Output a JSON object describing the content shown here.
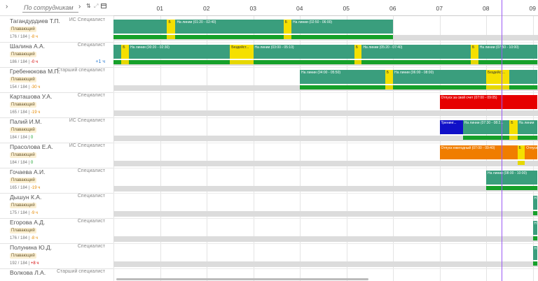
{
  "toolbar": {
    "expand_icon": "chevron-right",
    "search_placeholder": "По сотрудникам",
    "nav_icon": "chevron-right",
    "sort_icon": "sort",
    "calendar_icon": "calendar"
  },
  "timeline": {
    "hours": [
      "01",
      "02",
      "03",
      "04",
      "05",
      "06",
      "07",
      "08",
      "09"
    ]
  },
  "employees": [
    {
      "name": "Тагандурдиев Т.П.",
      "position": "ИС Специалист",
      "badge": "Плавающий",
      "hours": "176 / 184 |",
      "delta": "-8 ч",
      "delta_color": "#e68a00",
      "extra": ""
    },
    {
      "name": "Шалина А.А.",
      "position": "Специалист",
      "badge": "Плавающий",
      "hours": "186 / 184 |",
      "delta": "-0 ч",
      "delta_color": "#d40000",
      "extra": "+1 ч"
    },
    {
      "name": "Гребенюкова М.П.",
      "position": "Старший специалист",
      "badge": "Плавающий",
      "hours": "154 / 184 |",
      "delta": "-30 ч",
      "delta_color": "#e68a00",
      "extra": ""
    },
    {
      "name": "Карташова У.А.",
      "position": "Специалист",
      "badge": "Плавающий",
      "hours": "165 / 184 |",
      "delta": "-19 ч",
      "delta_color": "#e68a00",
      "extra": ""
    },
    {
      "name": "Палий И.М.",
      "position": "ИС Специалист",
      "badge": "Плавающий",
      "hours": "184 / 184 |",
      "delta": "0",
      "delta_color": "#16a12a",
      "extra": ""
    },
    {
      "name": "Прасолова Е.А.",
      "position": "ИС Специалист",
      "badge": "Плавающий",
      "hours": "184 / 184 |",
      "delta": "0",
      "delta_color": "#16a12a",
      "extra": ""
    },
    {
      "name": "Гочаева А.И.",
      "position": "Специалист",
      "badge": "Плавающий",
      "hours": "165 / 184 |",
      "delta": "-19 ч",
      "delta_color": "#e68a00",
      "extra": ""
    },
    {
      "name": "Дышун К.А.",
      "position": "Специалист",
      "badge": "Плавающий",
      "hours": "175 / 184 |",
      "delta": "-9 ч",
      "delta_color": "#e68a00",
      "extra": ""
    },
    {
      "name": "Егорова А.Д.",
      "position": "Специалист",
      "badge": "Плавающий",
      "hours": "176 / 184 |",
      "delta": "-8 ч",
      "delta_color": "#e68a00",
      "extra": ""
    },
    {
      "name": "Полунина Ю.Д.",
      "position": "Специалист",
      "badge": "Плавающий",
      "hours": "192 / 184 |",
      "delta": "+8 ч",
      "delta_color": "#d40000",
      "extra": ""
    },
    {
      "name": "Волкова Л.А.",
      "position": "Старший специалист",
      "badge": "",
      "hours": "",
      "delta": "",
      "delta_color": "#e68a00",
      "extra": ""
    }
  ],
  "shifts": [
    {
      "row": 0,
      "items": [
        {
          "start": 0.0,
          "end": 1.15,
          "color": "teal",
          "text": ""
        },
        {
          "start": 1.15,
          "end": 1.33,
          "color": "yellow",
          "text": "Б"
        },
        {
          "start": 1.33,
          "end": 3.65,
          "color": "teal",
          "text": "На линии (01:20 - 02:40)"
        },
        {
          "start": 3.65,
          "end": 3.82,
          "color": "yellow",
          "text": "Б"
        },
        {
          "start": 3.82,
          "end": 6.0,
          "color": "teal",
          "text": "На линии (02:50 - 06:00)"
        }
      ]
    },
    {
      "row": 1,
      "items": [
        {
          "start": 0.0,
          "end": 0.17,
          "color": "teal",
          "text": ""
        },
        {
          "start": 0.17,
          "end": 0.33,
          "color": "yellow",
          "text": "Б"
        },
        {
          "start": 0.33,
          "end": 2.5,
          "color": "teal",
          "text": "На линии (00:20 - 02:30)"
        },
        {
          "start": 2.5,
          "end": 3.0,
          "color": "yellow",
          "text": "Бездейст..."
        },
        {
          "start": 3.0,
          "end": 5.17,
          "color": "teal",
          "text": "На линии (03:00 - 05:10)"
        },
        {
          "start": 5.17,
          "end": 5.33,
          "color": "yellow",
          "text": "Б"
        },
        {
          "start": 5.33,
          "end": 7.67,
          "color": "teal",
          "text": "На линии (05:20 - 07:40)"
        },
        {
          "start": 7.67,
          "end": 7.83,
          "color": "yellow",
          "text": "Б"
        },
        {
          "start": 7.83,
          "end": 9.1,
          "color": "teal",
          "text": "На линии (07:50 - 10:00)"
        }
      ]
    },
    {
      "row": 2,
      "items": [
        {
          "start": 4.0,
          "end": 5.83,
          "color": "teal",
          "text": "На линии (04:00 - 05:50)"
        },
        {
          "start": 5.83,
          "end": 6.0,
          "color": "yellow",
          "text": "Б"
        },
        {
          "start": 6.0,
          "end": 8.0,
          "color": "teal",
          "text": "На линии (06:00 - 08:00)"
        },
        {
          "start": 8.0,
          "end": 8.5,
          "color": "yellow",
          "text": "Бездейст..."
        },
        {
          "start": 8.5,
          "end": 9.1,
          "color": "teal",
          "text": ""
        }
      ]
    },
    {
      "row": 3,
      "items": [
        {
          "start": 7.0,
          "end": 9.1,
          "color": "red",
          "text": "Отпуск за свой счет (07:00 - 09:05)"
        }
      ]
    },
    {
      "row": 4,
      "items": [
        {
          "start": 7.0,
          "end": 7.5,
          "color": "blue",
          "text": "Тренинг..."
        },
        {
          "start": 7.5,
          "end": 8.5,
          "color": "teal",
          "text": "На линии (07:30 - 08:2..."
        },
        {
          "start": 8.5,
          "end": 8.67,
          "color": "yellow",
          "text": "Б"
        },
        {
          "start": 8.67,
          "end": 9.1,
          "color": "teal",
          "text": "На линии"
        }
      ]
    },
    {
      "row": 5,
      "items": [
        {
          "start": 7.0,
          "end": 8.67,
          "color": "orange",
          "text": "Отпуск ежегодный (07:00 - 09:40)"
        },
        {
          "start": 8.67,
          "end": 8.83,
          "color": "yellow",
          "text": "Б"
        },
        {
          "start": 8.83,
          "end": 9.1,
          "color": "orange",
          "text": "Отпуск"
        }
      ]
    },
    {
      "row": 6,
      "items": [
        {
          "start": 8.0,
          "end": 9.1,
          "color": "teal",
          "text": "На линии (08:00 - 10:00)"
        }
      ]
    },
    {
      "row": 7,
      "items": [
        {
          "start": 9.0,
          "end": 9.1,
          "color": "teal",
          "text": "Н"
        }
      ]
    },
    {
      "row": 8,
      "items": [
        {
          "start": 9.0,
          "end": 9.1,
          "color": "teal",
          "text": "Н"
        }
      ]
    },
    {
      "row": 9,
      "items": [
        {
          "start": 9.0,
          "end": 9.1,
          "color": "teal",
          "text": "Н"
        }
      ]
    }
  ]
}
